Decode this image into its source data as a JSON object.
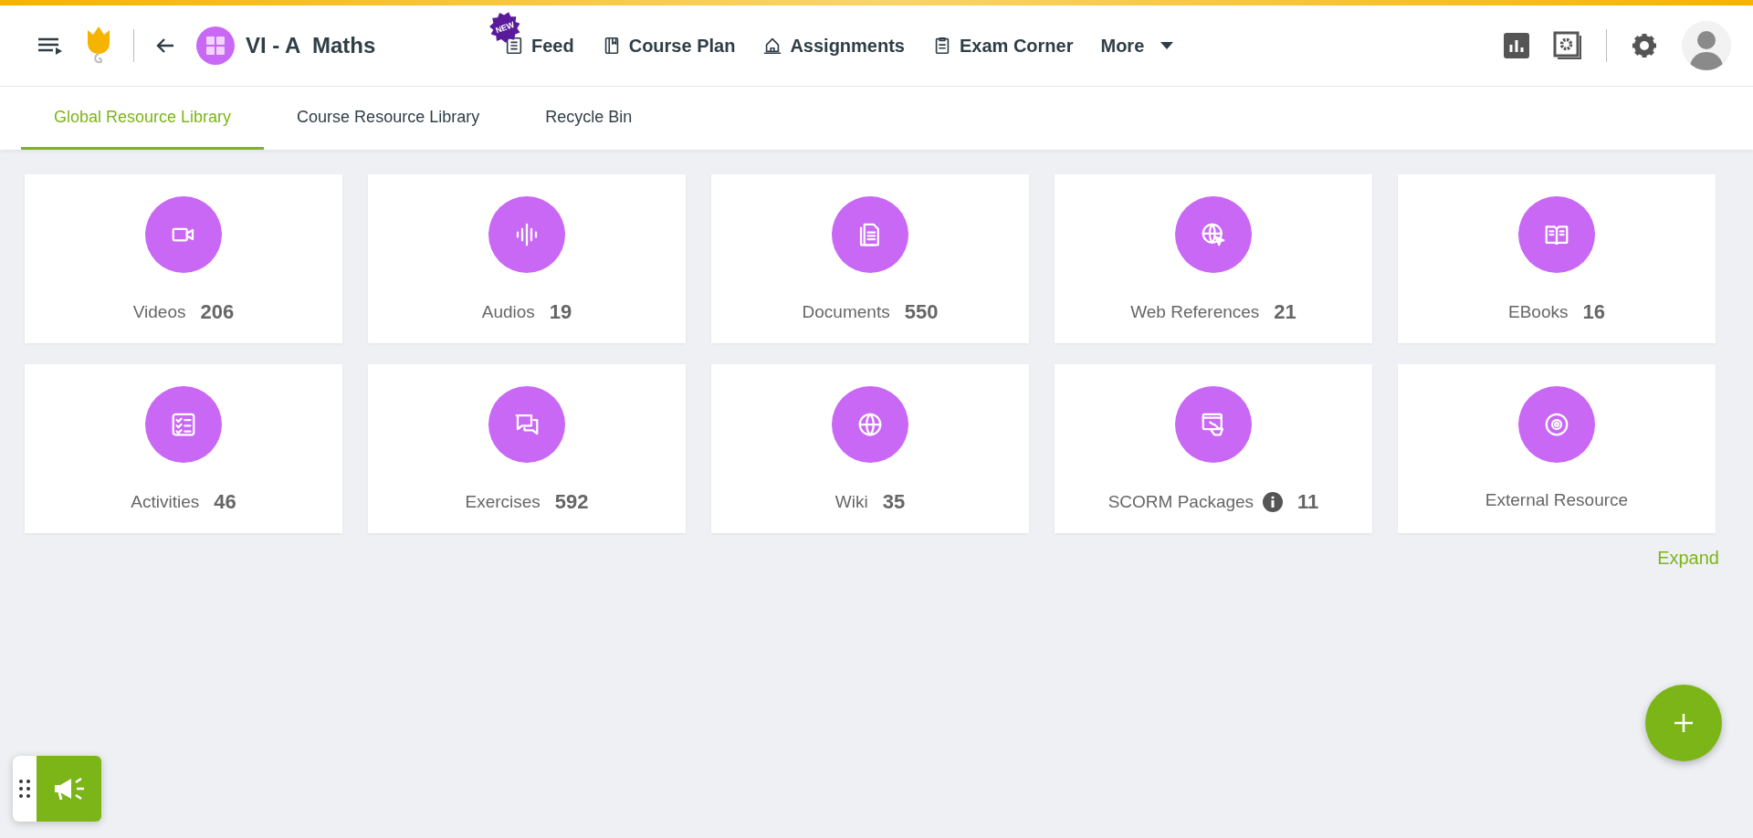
{
  "header": {
    "course_title": "VI - A  Maths",
    "nav": [
      {
        "label": "Feed",
        "badge": "NEW"
      },
      {
        "label": "Course Plan"
      },
      {
        "label": "Assignments"
      },
      {
        "label": "Exam Corner"
      },
      {
        "label": "More"
      }
    ]
  },
  "tabs": [
    {
      "label": "Global Resource Library",
      "selected": true
    },
    {
      "label": "Course Resource Library",
      "selected": false
    },
    {
      "label": "Recycle Bin",
      "selected": false
    }
  ],
  "resources": [
    {
      "label": "Videos",
      "count": "206"
    },
    {
      "label": "Audios",
      "count": "19"
    },
    {
      "label": "Documents",
      "count": "550"
    },
    {
      "label": "Web References",
      "count": "21"
    },
    {
      "label": "EBooks",
      "count": "16"
    },
    {
      "label": "Activities",
      "count": "46"
    },
    {
      "label": "Exercises",
      "count": "592"
    },
    {
      "label": "Wiki",
      "count": "35"
    },
    {
      "label": "SCORM Packages",
      "count": "11",
      "info": true
    },
    {
      "label": "External Resource"
    }
  ],
  "expand_link": "Expand"
}
